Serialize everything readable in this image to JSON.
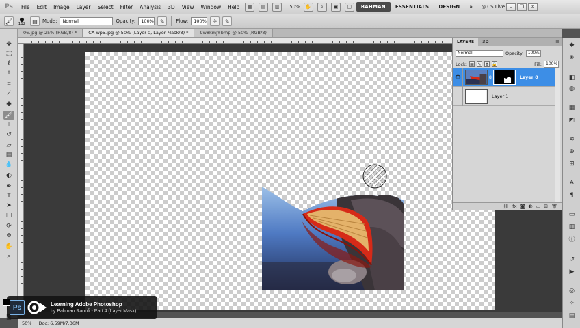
{
  "app": {
    "logo": "Ps"
  },
  "menu": [
    "File",
    "Edit",
    "Image",
    "Layer",
    "Select",
    "Filter",
    "Analysis",
    "3D",
    "View",
    "Window",
    "Help"
  ],
  "menubar": {
    "zoom": "50%",
    "workspaces": [
      "BAHMAN",
      "ESSENTIALS",
      "DESIGN"
    ],
    "more": "»",
    "cslive": "CS Live"
  },
  "options": {
    "brush_size": "112",
    "mode_label": "Mode:",
    "mode_value": "Normal",
    "opacity_label": "Opacity:",
    "opacity_value": "100%",
    "flow_label": "Flow:",
    "flow_value": "100%"
  },
  "tabs": [
    {
      "label": "06.jpg @ 25% (RGB/8) *",
      "active": false
    },
    {
      "label": "CA-wp5.jpg @ 50% (Layer 0, Layer Mask/8) *",
      "active": true
    },
    {
      "label": "9w8kmJY.bmp @ 50% (RGB/8)",
      "active": false
    }
  ],
  "tools": [
    "move-icon",
    "marquee-icon",
    "lasso-icon",
    "quick-select-icon",
    "crop-icon",
    "eyedropper-icon",
    "healing-icon",
    "brush-icon",
    "clone-stamp-icon",
    "history-brush-icon",
    "eraser-icon",
    "gradient-icon",
    "blur-icon",
    "dodge-icon",
    "pen-icon",
    "type-icon",
    "path-select-icon",
    "shape-icon",
    "3d-rotate-icon",
    "3d-orbit-icon",
    "hand-icon",
    "zoom-icon"
  ],
  "colors": {
    "foreground": "#000000",
    "background": "#ffffff",
    "selection": "#3d8ee6"
  },
  "status": {
    "zoom": "50%",
    "doc": "Doc: 6.59M/7.36M"
  },
  "layers_panel": {
    "tabs": [
      "LAYERS",
      "3D"
    ],
    "blend_mode": "Normal",
    "opacity_label": "Opacity:",
    "opacity_value": "100%",
    "lock_label": "Lock:",
    "fill_label": "Fill:",
    "fill_value": "100%",
    "layers": [
      {
        "name": "Layer 0",
        "selected": true,
        "visible": true,
        "has_mask": true
      },
      {
        "name": "Layer 1",
        "selected": false,
        "visible": false,
        "has_mask": false
      }
    ]
  },
  "overlay": {
    "badge": "Ps",
    "title": "Learning Adobe Photoshop",
    "subtitle": "by Bahman Raoufi - Part 4 (Layer Mask)"
  }
}
